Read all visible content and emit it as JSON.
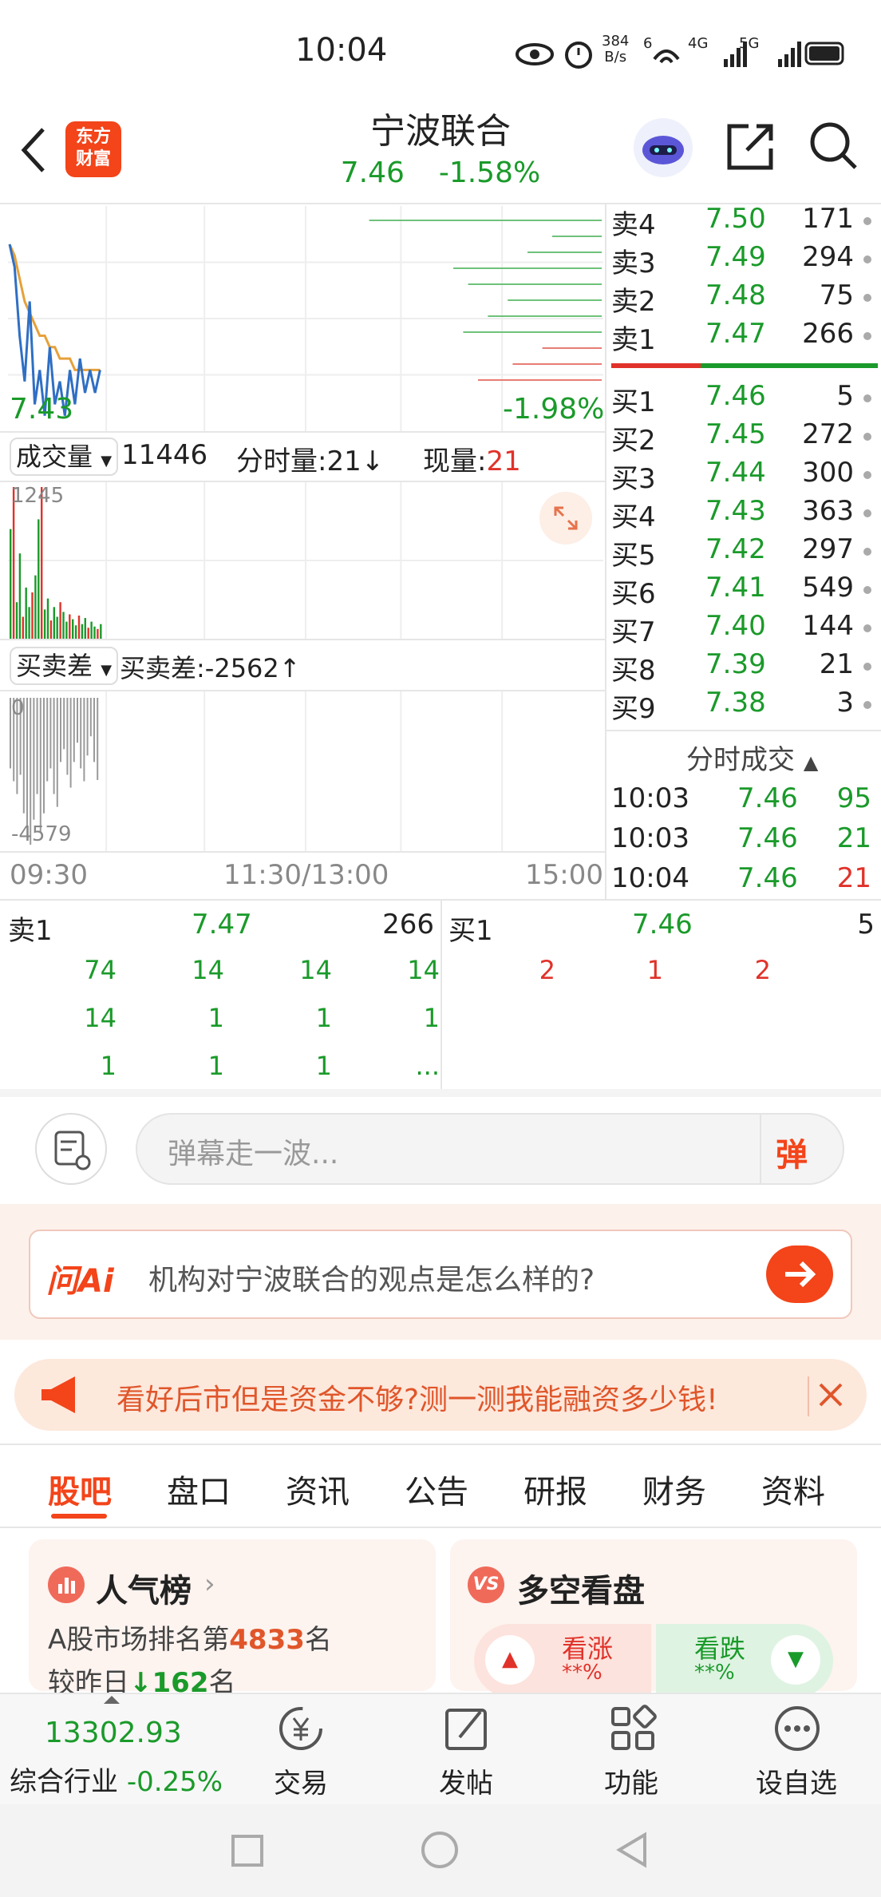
{
  "status_bar": {
    "time": "10:04",
    "net_speed_top": "384",
    "net_speed_bottom": "B/s",
    "sig1": "6",
    "sig2": "4G",
    "sig3": "5G"
  },
  "header": {
    "logo_top": "东方",
    "logo_bottom": "财富",
    "title": "宁波联合",
    "price": "7.46",
    "change": "-1.58%"
  },
  "chart": {
    "price_low_label": "7.43",
    "pct_low_label": "-1.98%",
    "volume_selector": "成交量",
    "volume_total": "11446",
    "minute_volume_label": "分时量:21↓",
    "current_volume_label": "现量:",
    "current_volume_value": "21",
    "volume_axis_max": "1245",
    "diff_selector": "买卖差",
    "diff_label": "买卖差:-2562↑",
    "diff_axis_top": "0",
    "diff_axis_bottom": "-4579",
    "time_start": "09:30",
    "time_mid": "11:30/13:00",
    "time_end": "15:00",
    "price_series": [
      7.58,
      7.56,
      7.5,
      7.46,
      7.53,
      7.44,
      7.47,
      7.43,
      7.49,
      7.44,
      7.46,
      7.43,
      7.47,
      7.44,
      7.48,
      7.45,
      7.47,
      7.45,
      7.47
    ],
    "avg_series": [
      7.58,
      7.57,
      7.55,
      7.53,
      7.52,
      7.51,
      7.5,
      7.5,
      7.49,
      7.49,
      7.48,
      7.48,
      7.48,
      7.47,
      7.47,
      7.47,
      7.47,
      7.47,
      7.47
    ]
  },
  "order_book": {
    "asks": [
      {
        "label": "卖4",
        "price": "7.50",
        "vol": "171"
      },
      {
        "label": "卖3",
        "price": "7.49",
        "vol": "294"
      },
      {
        "label": "卖2",
        "price": "7.48",
        "vol": "75"
      },
      {
        "label": "卖1",
        "price": "7.47",
        "vol": "266"
      }
    ],
    "bids": [
      {
        "label": "买1",
        "price": "7.46",
        "vol": "5"
      },
      {
        "label": "买2",
        "price": "7.45",
        "vol": "272"
      },
      {
        "label": "买3",
        "price": "7.44",
        "vol": "300"
      },
      {
        "label": "买4",
        "price": "7.43",
        "vol": "363"
      },
      {
        "label": "买5",
        "price": "7.42",
        "vol": "297"
      },
      {
        "label": "买6",
        "price": "7.41",
        "vol": "549"
      },
      {
        "label": "买7",
        "price": "7.40",
        "vol": "144"
      },
      {
        "label": "买8",
        "price": "7.39",
        "vol": "21"
      },
      {
        "label": "买9",
        "price": "7.38",
        "vol": "3"
      }
    ],
    "ticks_header": "分时成交",
    "ticks": [
      {
        "time": "10:03",
        "price": "7.46",
        "vol": "95"
      },
      {
        "time": "10:03",
        "price": "7.46",
        "vol": "21"
      },
      {
        "time": "10:04",
        "price": "7.46",
        "vol": "21"
      }
    ]
  },
  "queue": {
    "sell_label": "卖1",
    "sell_price": "7.47",
    "sell_total": "266",
    "buy_label": "买1",
    "buy_price": "7.46",
    "buy_total": "5",
    "sell_rows": [
      [
        "74",
        "14",
        "14",
        "14"
      ],
      [
        "14",
        "1",
        "1",
        "1"
      ],
      [
        "1",
        "1",
        "1",
        "..."
      ]
    ],
    "buy_rows": [
      [
        "2",
        "1",
        "2"
      ]
    ]
  },
  "danmaku": {
    "placeholder": "弹幕走一波...",
    "send_label": "弹"
  },
  "ai": {
    "logo": "问Ai",
    "question": "机构对宁波联合的观点是怎么样的?"
  },
  "promo": {
    "text": "看好后市但是资金不够?测一测我能融资多少钱!"
  },
  "tabs": [
    "股吧",
    "盘口",
    "资讯",
    "公告",
    "研报",
    "财务",
    "资料"
  ],
  "popularity": {
    "title": "人气榜",
    "rank_prefix": "A股市场排名第",
    "rank_value": "4833",
    "rank_suffix": "名",
    "change_prefix": "较昨日",
    "change_value": "162",
    "change_suffix": "名"
  },
  "sentiment": {
    "title": "多空看盘",
    "up_label": "看涨",
    "up_value": "**%",
    "down_label": "看跌",
    "down_value": "**%"
  },
  "bottom_bar": {
    "index_value": "13302.93",
    "index_name": "综合行业",
    "index_change": "-0.25%",
    "items": [
      "交易",
      "发帖",
      "功能",
      "设自选"
    ]
  },
  "colors": {
    "up": "#e0322a",
    "down": "#1a9a2a",
    "accent": "#f3441a",
    "price_line": "#2f6fc4",
    "avg_line": "#e6a13a"
  }
}
